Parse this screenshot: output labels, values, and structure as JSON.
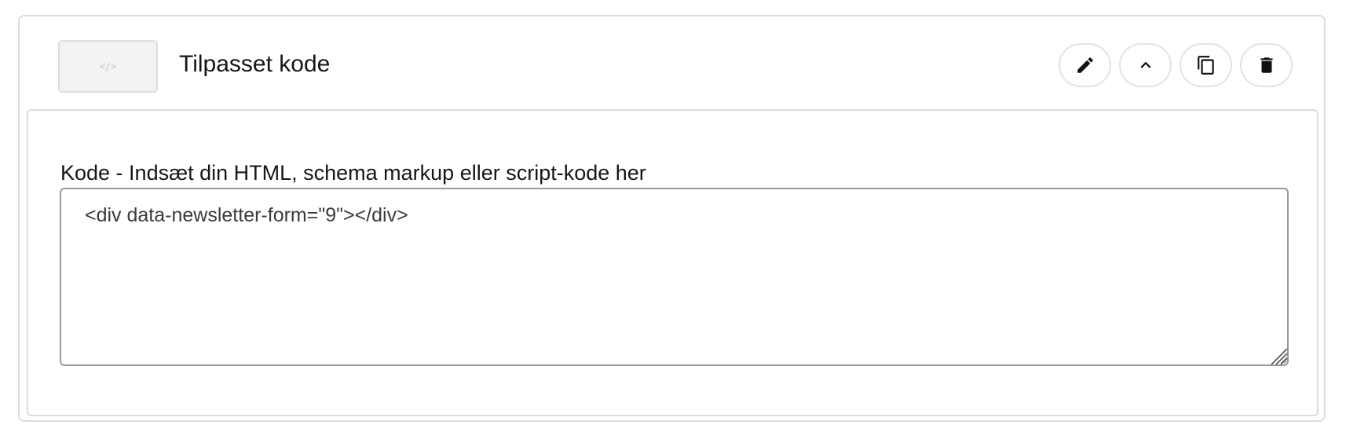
{
  "block": {
    "thumbnail_text": "</>",
    "title": "Tilpasset kode",
    "actions": {
      "edit": "pencil-icon",
      "collapse": "chevron-up-icon",
      "duplicate": "copy-icon",
      "delete": "trash-icon"
    }
  },
  "field": {
    "label": "Kode - Indsæt din HTML, schema markup eller script-kode her",
    "value": "<div data-newsletter-form=\"9\"></div>"
  }
}
